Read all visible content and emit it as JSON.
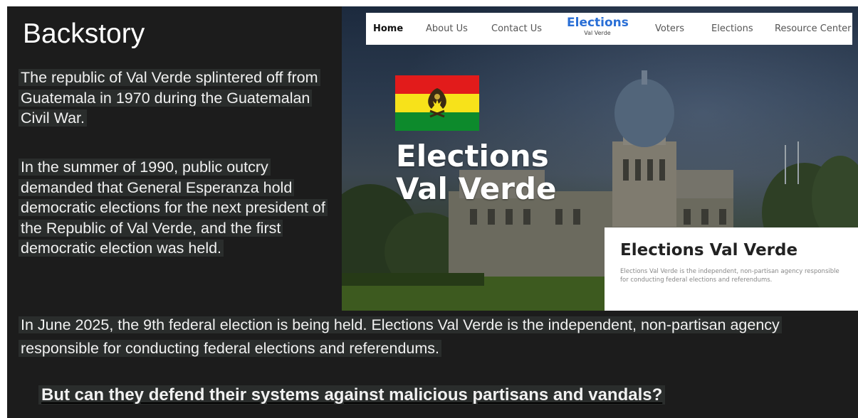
{
  "slide": {
    "title": "Backstory",
    "paragraphs": [
      "The republic of Val Verde splintered off from Guatemala in 1970 during the Guatemalan Civil War.",
      "In the summer of 1990, public outcry demanded that General Esperanza hold democratic elections for the next president of the Republic of Val Verde, and the first democratic election was held.",
      "In June 2025, the 9th federal election is being held.  Elections Val Verde is the independent, non-partisan agency responsible for conducting federal elections and referendums."
    ],
    "tagline": "But can they defend their systems against malicious partisans and vandals?"
  },
  "website": {
    "nav": {
      "items": [
        "Home",
        "About Us",
        "Contact Us",
        "Voters",
        "Elections",
        "Resource Center"
      ],
      "brand_title": "Elections",
      "brand_subtitle": "Val Verde"
    },
    "hero_lines": [
      "Elections",
      "Val Verde"
    ],
    "card": {
      "title": "Elections Val Verde",
      "text": "Elections Val Verde is the independent, non-partisan agency responsible for conducting federal elections and referendums."
    }
  },
  "colors": {
    "slide_background": "#1c1c1c",
    "text_highlight": "#2a2d2c",
    "brand_blue": "#2a6fd6",
    "flag": [
      "#e21b1b",
      "#f7e21a",
      "#0d8a2c"
    ]
  }
}
